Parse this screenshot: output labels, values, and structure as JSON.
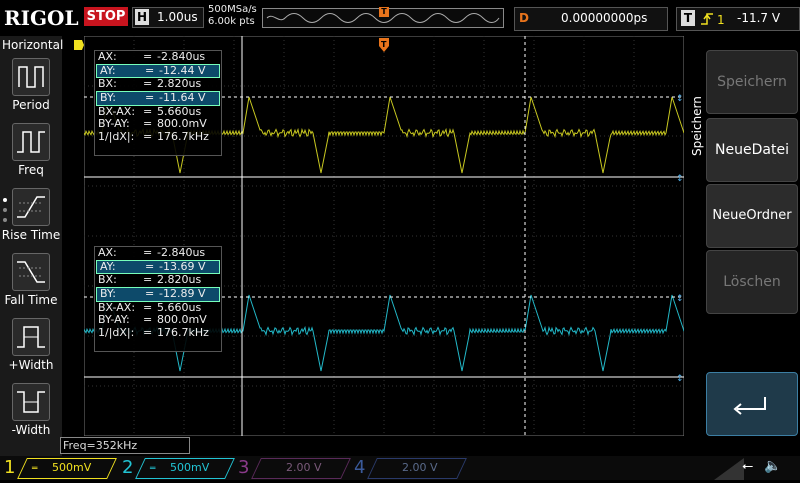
{
  "header": {
    "logo": "RIGOL",
    "run_state": "STOP",
    "timebase_tag": "H",
    "timebase_value": "1.00us",
    "sample_rate": "500MSa/s",
    "memory_depth": "6.00k pts",
    "delay_tag": "D",
    "delay_value": "0.00000000ps",
    "trigger_tag": "T",
    "trigger_level": "-11.7 V"
  },
  "left_menu": {
    "title": "Horizontal",
    "items": [
      {
        "label": "Period",
        "icon": "period-icon"
      },
      {
        "label": "Freq",
        "icon": "freq-icon"
      },
      {
        "label": "Rise Time",
        "icon": "rise-time-icon"
      },
      {
        "label": "Fall Time",
        "icon": "fall-time-icon"
      },
      {
        "label": "+Width",
        "icon": "pos-width-icon"
      },
      {
        "label": "-Width",
        "icon": "neg-width-icon"
      }
    ]
  },
  "measurements": [
    {
      "rows": [
        {
          "label": "AX:",
          "value": "-2.840us"
        },
        {
          "label": "AY:",
          "value": "-12.44 V"
        },
        {
          "label": "BX:",
          "value": "2.820us"
        },
        {
          "label": "BY:",
          "value": "-11.64 V"
        },
        {
          "label": "BX-AX:",
          "value": "5.660us"
        },
        {
          "label": "BY-AY:",
          "value": "800.0mV"
        },
        {
          "label": "1/|dX|:",
          "value": "176.7kHz"
        }
      ]
    },
    {
      "rows": [
        {
          "label": "AX:",
          "value": "-2.840us"
        },
        {
          "label": "AY:",
          "value": "-13.69 V"
        },
        {
          "label": "BX:",
          "value": "2.820us"
        },
        {
          "label": "BY:",
          "value": "-12.89 V"
        },
        {
          "label": "BX-AX:",
          "value": "5.660us"
        },
        {
          "label": "BY-AY:",
          "value": "800.0mV"
        },
        {
          "label": "1/|dX|:",
          "value": "176.7kHz"
        }
      ]
    }
  ],
  "freq_readout": "Freq=352kHz",
  "right_menu": {
    "title": "Speichern",
    "buttons": [
      {
        "label": "Speichern",
        "enabled": false
      },
      {
        "label": "NeueDatei",
        "enabled": true
      },
      {
        "label": "NeueOrdner",
        "enabled": true
      },
      {
        "label": "Löschen",
        "enabled": false
      }
    ]
  },
  "channels": [
    {
      "num": "1",
      "scale": "500mV",
      "color": "#f0e020",
      "active": true
    },
    {
      "num": "2",
      "scale": "500mV",
      "color": "#22c4d4",
      "active": true
    },
    {
      "num": "3",
      "scale": "2.00 V",
      "color": "#c040c0",
      "active": false
    },
    {
      "num": "4",
      "scale": "2.00 V",
      "color": "#3070d0",
      "active": false
    }
  ],
  "colors": {
    "ch1": "#c8c820",
    "ch2": "#22b8c8",
    "trigger": "#e8741c",
    "grid": "#333333"
  }
}
